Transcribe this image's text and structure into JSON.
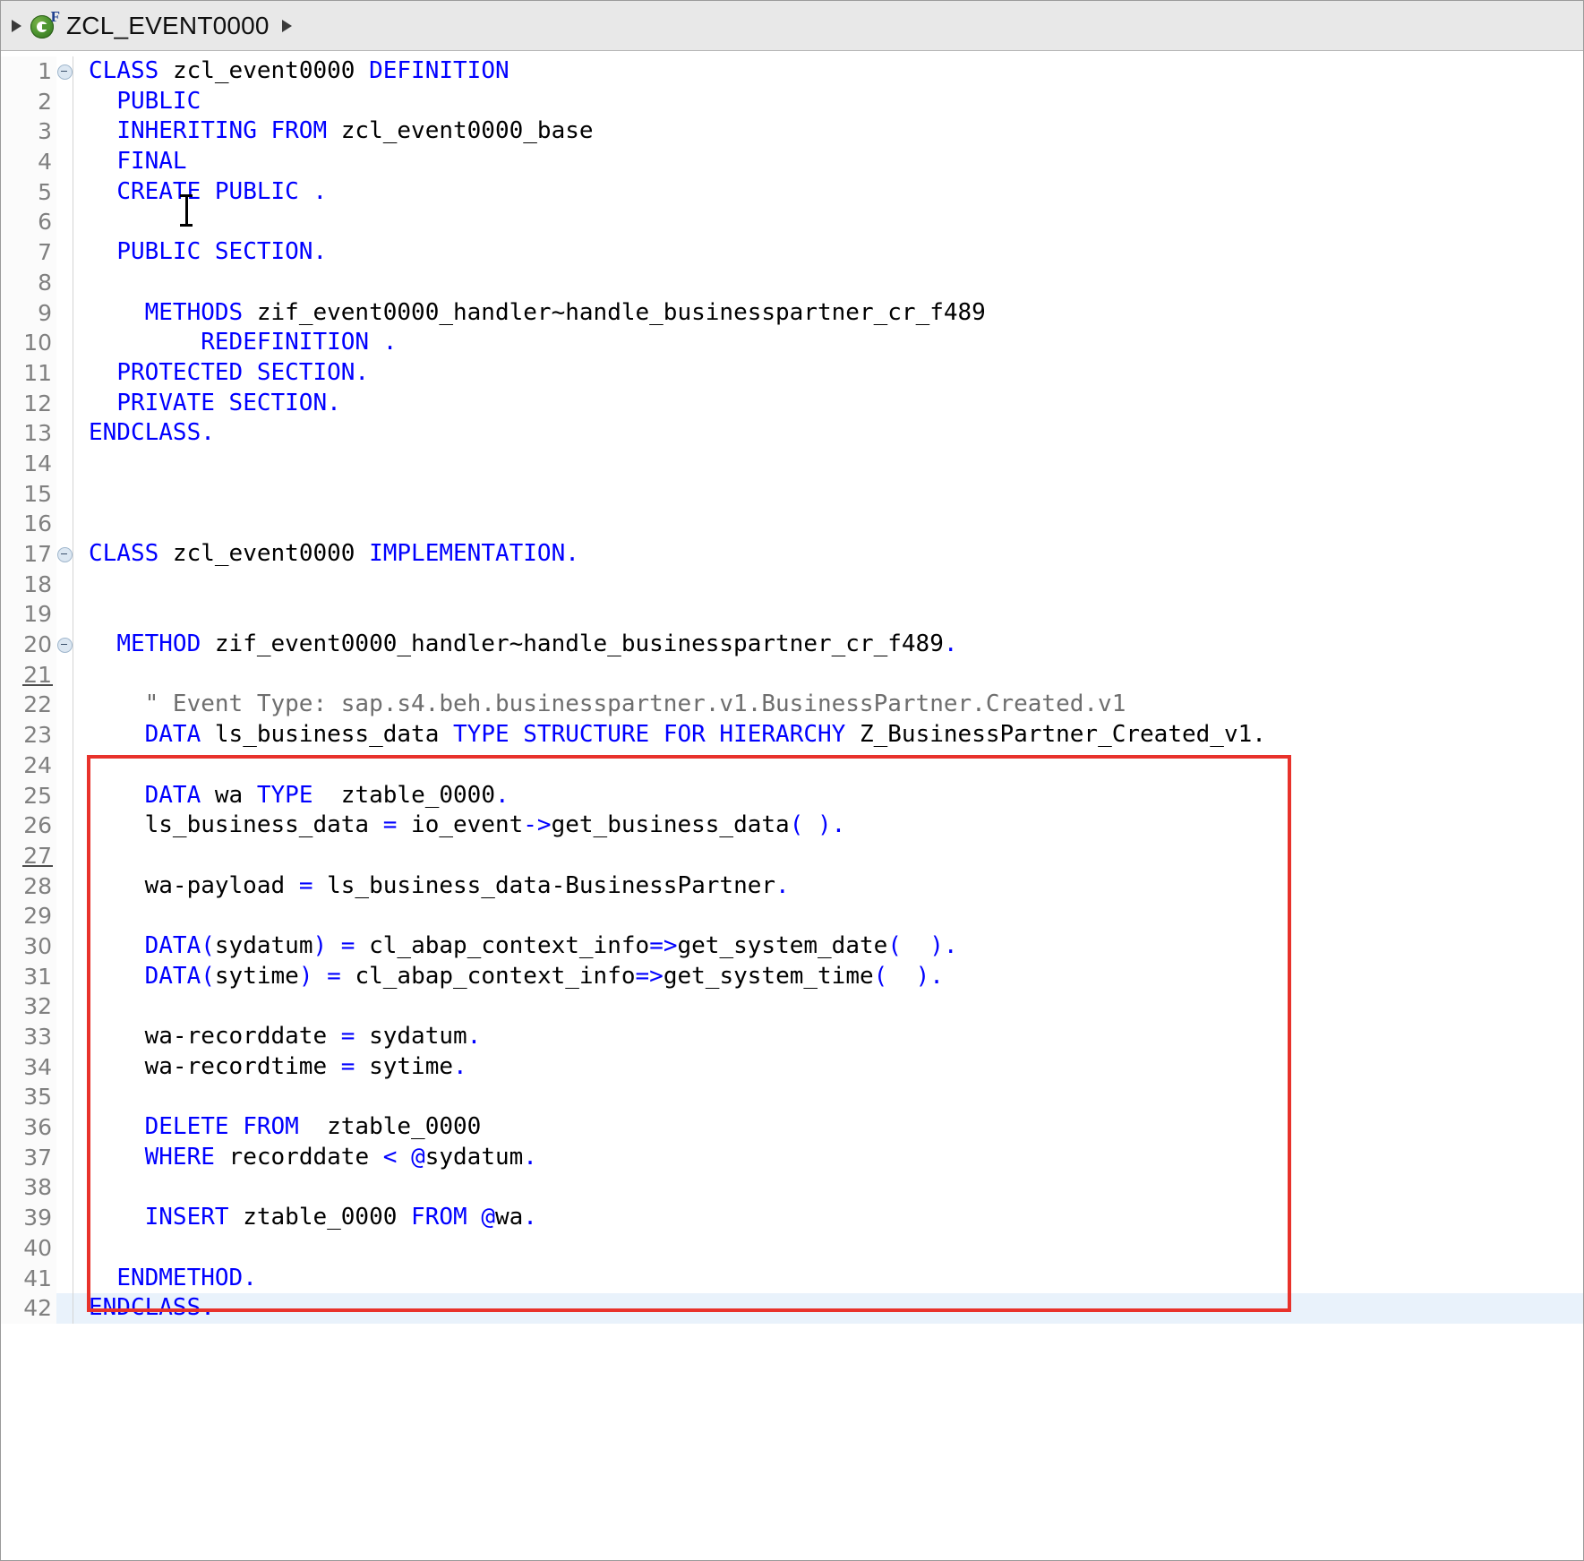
{
  "window": {
    "title": "ZCL_EVENT0000"
  },
  "breadcrumb": {
    "expand_arrow": "▸",
    "class_icon": "abap-class-icon",
    "icon_superscript": "F",
    "label": "ZCL_EVENT0000",
    "next_arrow": "▸"
  },
  "editor": {
    "current_line": 42,
    "highlight_box": {
      "color": "#e8322b",
      "from_line": 23,
      "to_line": 39
    },
    "colors": {
      "keyword": "#0000ff",
      "identifier": "#000000",
      "comment": "#6e6e6e",
      "gutter_text": "#808080",
      "current_line_bg": "#e9f2fb",
      "box_border": "#e8322b"
    },
    "lines": [
      {
        "n": "1",
        "fold": true,
        "marked": false,
        "tokens": [
          {
            "t": "CLASS",
            "c": "k"
          },
          {
            "t": " ",
            "c": "id"
          },
          {
            "t": "zcl_event0000",
            "c": "id"
          },
          {
            "t": " ",
            "c": "id"
          },
          {
            "t": "DEFINITION",
            "c": "k"
          }
        ]
      },
      {
        "n": "2",
        "fold": false,
        "marked": false,
        "tokens": [
          {
            "t": "  ",
            "c": "id"
          },
          {
            "t": "PUBLIC",
            "c": "k"
          }
        ]
      },
      {
        "n": "3",
        "fold": false,
        "marked": false,
        "tokens": [
          {
            "t": "  ",
            "c": "id"
          },
          {
            "t": "INHERITING FROM",
            "c": "k"
          },
          {
            "t": " zcl_event0000_base",
            "c": "id"
          }
        ]
      },
      {
        "n": "4",
        "fold": false,
        "marked": false,
        "tokens": [
          {
            "t": "  ",
            "c": "id"
          },
          {
            "t": "FINAL",
            "c": "k"
          }
        ]
      },
      {
        "n": "5",
        "fold": false,
        "marked": false,
        "tokens": [
          {
            "t": "  ",
            "c": "id"
          },
          {
            "t": "CREATE PUBLIC .",
            "c": "k"
          }
        ]
      },
      {
        "n": "6",
        "fold": false,
        "marked": false,
        "tokens": [
          {
            "t": "",
            "c": "id"
          }
        ]
      },
      {
        "n": "7",
        "fold": false,
        "marked": false,
        "tokens": [
          {
            "t": "  ",
            "c": "id"
          },
          {
            "t": "PUBLIC SECTION.",
            "c": "k"
          }
        ]
      },
      {
        "n": "8",
        "fold": false,
        "marked": false,
        "tokens": [
          {
            "t": "",
            "c": "id"
          }
        ]
      },
      {
        "n": "9",
        "fold": false,
        "marked": false,
        "tokens": [
          {
            "t": "    ",
            "c": "id"
          },
          {
            "t": "METHODS",
            "c": "k"
          },
          {
            "t": " zif_event0000_handler~handle_businesspartner_cr_f489",
            "c": "id"
          }
        ]
      },
      {
        "n": "10",
        "fold": false,
        "marked": false,
        "tokens": [
          {
            "t": "        ",
            "c": "id"
          },
          {
            "t": "REDEFINITION .",
            "c": "k"
          }
        ]
      },
      {
        "n": "11",
        "fold": false,
        "marked": false,
        "tokens": [
          {
            "t": "  ",
            "c": "id"
          },
          {
            "t": "PROTECTED SECTION.",
            "c": "k"
          }
        ]
      },
      {
        "n": "12",
        "fold": false,
        "marked": false,
        "tokens": [
          {
            "t": "  ",
            "c": "id"
          },
          {
            "t": "PRIVATE SECTION.",
            "c": "k"
          }
        ]
      },
      {
        "n": "13",
        "fold": false,
        "marked": false,
        "tokens": [
          {
            "t": "ENDCLASS.",
            "c": "k"
          }
        ]
      },
      {
        "n": "14",
        "fold": false,
        "marked": false,
        "tokens": [
          {
            "t": "",
            "c": "id"
          }
        ]
      },
      {
        "n": "15",
        "fold": false,
        "marked": false,
        "tokens": [
          {
            "t": "",
            "c": "id"
          }
        ]
      },
      {
        "n": "16",
        "fold": false,
        "marked": false,
        "tokens": [
          {
            "t": "",
            "c": "id"
          }
        ]
      },
      {
        "n": "17",
        "fold": true,
        "marked": false,
        "tokens": [
          {
            "t": "CLASS",
            "c": "k"
          },
          {
            "t": " zcl_event0000 ",
            "c": "id"
          },
          {
            "t": "IMPLEMENTATION.",
            "c": "k"
          }
        ]
      },
      {
        "n": "18",
        "fold": false,
        "marked": false,
        "tokens": [
          {
            "t": "",
            "c": "id"
          }
        ]
      },
      {
        "n": "19",
        "fold": false,
        "marked": false,
        "tokens": [
          {
            "t": "",
            "c": "id"
          }
        ]
      },
      {
        "n": "20",
        "fold": true,
        "marked": false,
        "tokens": [
          {
            "t": "  ",
            "c": "id"
          },
          {
            "t": "METHOD",
            "c": "k"
          },
          {
            "t": " zif_event0000_handler~handle_businesspartner_cr_f489",
            "c": "id"
          },
          {
            "t": ".",
            "c": "k"
          }
        ]
      },
      {
        "n": "21",
        "fold": false,
        "marked": true,
        "tokens": [
          {
            "t": "",
            "c": "id"
          }
        ]
      },
      {
        "n": "22",
        "fold": false,
        "marked": false,
        "tokens": [
          {
            "t": "    \" Event Type: sap.s4.beh.businesspartner.v1.BusinessPartner.Created.v1",
            "c": "cm"
          }
        ]
      },
      {
        "n": "23",
        "fold": false,
        "marked": false,
        "tokens": [
          {
            "t": "    ",
            "c": "id"
          },
          {
            "t": "DATA",
            "c": "k"
          },
          {
            "t": " ls_business_data ",
            "c": "id"
          },
          {
            "t": "TYPE STRUCTURE FOR HIERARCHY",
            "c": "k"
          },
          {
            "t": " Z_BusinessPartner_Created_v1.",
            "c": "id"
          }
        ]
      },
      {
        "n": "24",
        "fold": false,
        "marked": false,
        "tokens": [
          {
            "t": "",
            "c": "id"
          }
        ]
      },
      {
        "n": "25",
        "fold": false,
        "marked": false,
        "tokens": [
          {
            "t": "    ",
            "c": "id"
          },
          {
            "t": "DATA",
            "c": "k"
          },
          {
            "t": " wa ",
            "c": "id"
          },
          {
            "t": "TYPE",
            "c": "k"
          },
          {
            "t": "  ztable_0000",
            "c": "id"
          },
          {
            "t": ".",
            "c": "k"
          }
        ]
      },
      {
        "n": "26",
        "fold": false,
        "marked": false,
        "tokens": [
          {
            "t": "    ls_business_data ",
            "c": "id"
          },
          {
            "t": "=",
            "c": "k"
          },
          {
            "t": " io_event",
            "c": "id"
          },
          {
            "t": "->",
            "c": "k"
          },
          {
            "t": "get_business_data",
            "c": "id"
          },
          {
            "t": "( ).",
            "c": "k"
          }
        ]
      },
      {
        "n": "27",
        "fold": false,
        "marked": true,
        "tokens": [
          {
            "t": "",
            "c": "id"
          }
        ]
      },
      {
        "n": "28",
        "fold": false,
        "marked": false,
        "tokens": [
          {
            "t": "    wa-payload ",
            "c": "id"
          },
          {
            "t": "=",
            "c": "k"
          },
          {
            "t": " ls_business_data-BusinessPartner",
            "c": "id"
          },
          {
            "t": ".",
            "c": "k"
          }
        ]
      },
      {
        "n": "29",
        "fold": false,
        "marked": false,
        "tokens": [
          {
            "t": "",
            "c": "id"
          }
        ]
      },
      {
        "n": "30",
        "fold": false,
        "marked": false,
        "tokens": [
          {
            "t": "    ",
            "c": "id"
          },
          {
            "t": "DATA(",
            "c": "k"
          },
          {
            "t": "sydatum",
            "c": "id"
          },
          {
            "t": ")",
            "c": "k"
          },
          {
            "t": " ",
            "c": "id"
          },
          {
            "t": "=",
            "c": "k"
          },
          {
            "t": " cl_abap_context_info",
            "c": "id"
          },
          {
            "t": "=>",
            "c": "k"
          },
          {
            "t": "get_system_date",
            "c": "id"
          },
          {
            "t": "(  ).",
            "c": "k"
          }
        ]
      },
      {
        "n": "31",
        "fold": false,
        "marked": false,
        "tokens": [
          {
            "t": "    ",
            "c": "id"
          },
          {
            "t": "DATA(",
            "c": "k"
          },
          {
            "t": "sytime",
            "c": "id"
          },
          {
            "t": ")",
            "c": "k"
          },
          {
            "t": " ",
            "c": "id"
          },
          {
            "t": "=",
            "c": "k"
          },
          {
            "t": " cl_abap_context_info",
            "c": "id"
          },
          {
            "t": "=>",
            "c": "k"
          },
          {
            "t": "get_system_time",
            "c": "id"
          },
          {
            "t": "(  ).",
            "c": "k"
          }
        ]
      },
      {
        "n": "32",
        "fold": false,
        "marked": false,
        "tokens": [
          {
            "t": "",
            "c": "id"
          }
        ]
      },
      {
        "n": "33",
        "fold": false,
        "marked": false,
        "tokens": [
          {
            "t": "    wa-recorddate ",
            "c": "id"
          },
          {
            "t": "=",
            "c": "k"
          },
          {
            "t": " sydatum",
            "c": "id"
          },
          {
            "t": ".",
            "c": "k"
          }
        ]
      },
      {
        "n": "34",
        "fold": false,
        "marked": false,
        "tokens": [
          {
            "t": "    wa-recordtime ",
            "c": "id"
          },
          {
            "t": "=",
            "c": "k"
          },
          {
            "t": " sytime",
            "c": "id"
          },
          {
            "t": ".",
            "c": "k"
          }
        ]
      },
      {
        "n": "35",
        "fold": false,
        "marked": false,
        "tokens": [
          {
            "t": "",
            "c": "id"
          }
        ]
      },
      {
        "n": "36",
        "fold": false,
        "marked": false,
        "tokens": [
          {
            "t": "    ",
            "c": "id"
          },
          {
            "t": "DELETE FROM",
            "c": "k"
          },
          {
            "t": "  ztable_0000",
            "c": "id"
          }
        ]
      },
      {
        "n": "37",
        "fold": false,
        "marked": false,
        "tokens": [
          {
            "t": "    ",
            "c": "id"
          },
          {
            "t": "WHERE",
            "c": "k"
          },
          {
            "t": " recorddate ",
            "c": "id"
          },
          {
            "t": "<",
            "c": "k"
          },
          {
            "t": " ",
            "c": "id"
          },
          {
            "t": "@",
            "c": "k"
          },
          {
            "t": "sydatum",
            "c": "id"
          },
          {
            "t": ".",
            "c": "k"
          }
        ]
      },
      {
        "n": "38",
        "fold": false,
        "marked": false,
        "tokens": [
          {
            "t": "",
            "c": "id"
          }
        ]
      },
      {
        "n": "39",
        "fold": false,
        "marked": false,
        "tokens": [
          {
            "t": "    ",
            "c": "id"
          },
          {
            "t": "INSERT",
            "c": "k"
          },
          {
            "t": " ztable_0000 ",
            "c": "id"
          },
          {
            "t": "FROM",
            "c": "k"
          },
          {
            "t": " ",
            "c": "id"
          },
          {
            "t": "@",
            "c": "k"
          },
          {
            "t": "wa",
            "c": "id"
          },
          {
            "t": ".",
            "c": "k"
          }
        ]
      },
      {
        "n": "40",
        "fold": false,
        "marked": false,
        "tokens": [
          {
            "t": "",
            "c": "id"
          }
        ]
      },
      {
        "n": "41",
        "fold": false,
        "marked": false,
        "tokens": [
          {
            "t": "  ",
            "c": "id"
          },
          {
            "t": "ENDMETHOD.",
            "c": "k"
          }
        ]
      },
      {
        "n": "42",
        "fold": false,
        "marked": false,
        "current": true,
        "tokens": [
          {
            "t": "ENDCLASS.",
            "c": "k"
          }
        ]
      }
    ]
  }
}
